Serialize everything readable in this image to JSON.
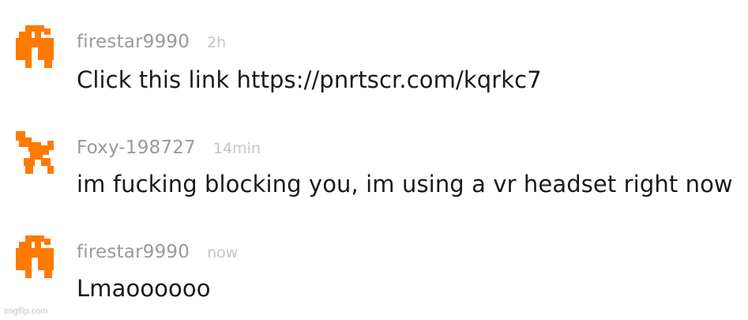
{
  "comments": [
    {
      "username": "firestar9990",
      "time": "2h",
      "text": "Click this link https://pnrtscr.com/kqrkc7",
      "avatar_icon": "pixel-avatar-orange-a"
    },
    {
      "username": "Foxy-198727",
      "time": "14min",
      "text": "im fucking blocking you, im using a vr headset right now",
      "avatar_icon": "pixel-avatar-orange-b"
    },
    {
      "username": "firestar9990",
      "time": "now",
      "text": "Lmaoooooo",
      "avatar_icon": "pixel-avatar-orange-a"
    }
  ],
  "colors": {
    "avatar_orange": "#ff7a00",
    "username_gray": "#9a9a9a",
    "time_gray": "#c4c4c4",
    "text": "#1a1a1a"
  },
  "watermark": "imgflip.com"
}
